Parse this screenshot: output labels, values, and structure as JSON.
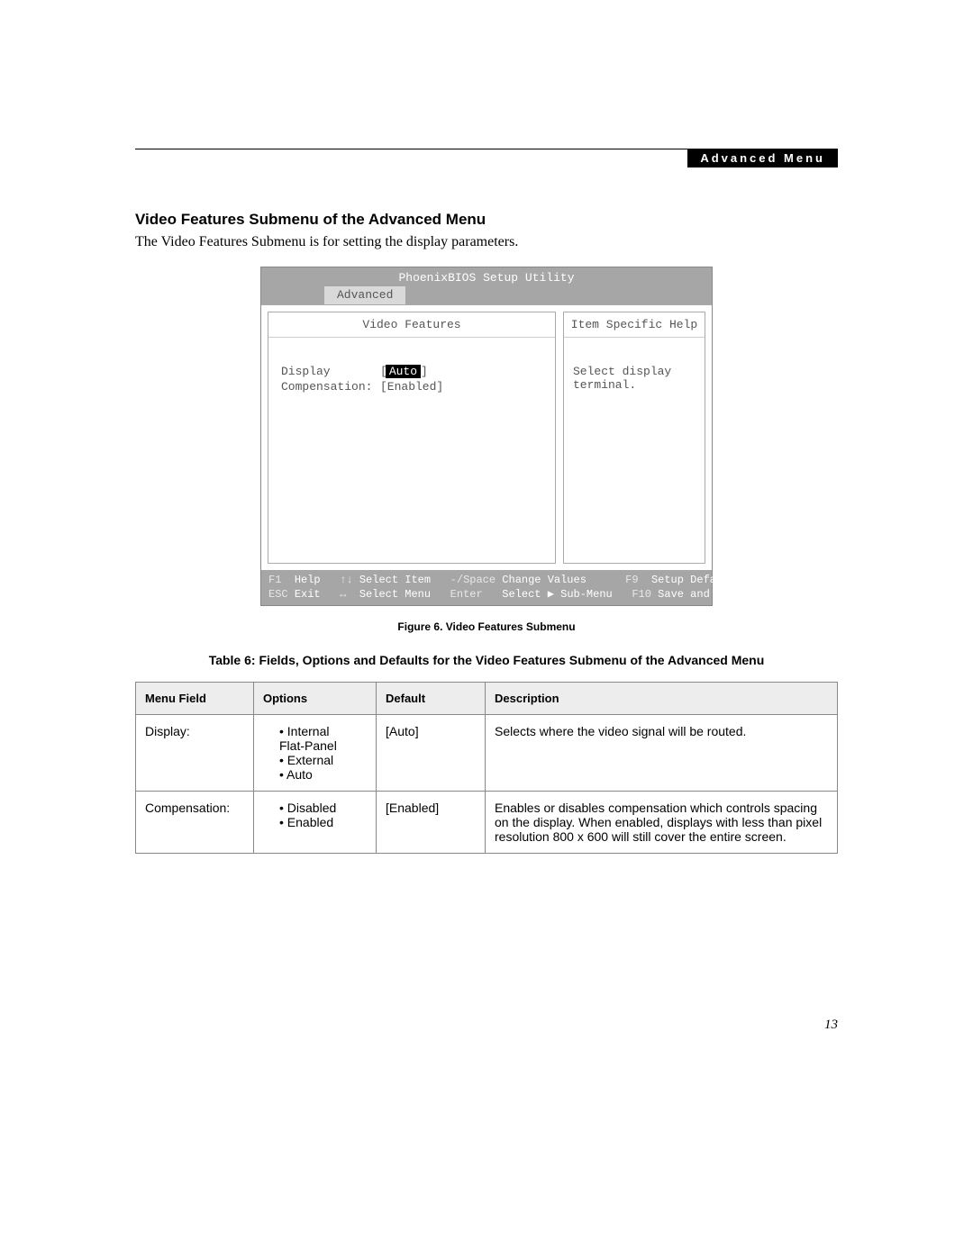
{
  "header": {
    "banner": "Advanced Menu"
  },
  "section": {
    "title": "Video Features Submenu of the Advanced Menu",
    "intro": "The Video Features Submenu is for setting the display parameters."
  },
  "bios": {
    "utility_title": "PhoenixBIOS Setup Utility",
    "active_tab": "Advanced",
    "left_header": "Video Features",
    "right_header": "Item Specific Help",
    "fields": {
      "display_label": "Display",
      "display_value": "Auto",
      "display_bracket_open": "[",
      "display_bracket_close": "]",
      "comp_label": "Compensation:",
      "comp_value": "[Enabled]"
    },
    "help_text": "Select display terminal.",
    "footer": {
      "r1_k1": "F1",
      "r1_l1": "Help",
      "r1_k2": "↑↓",
      "r1_l2": "Select Item",
      "r1_k3": "-/Space",
      "r1_l3": "Change Values",
      "r1_k4": "F9",
      "r1_l4": "Setup Defaults",
      "r2_k1": "ESC",
      "r2_l1": "Exit",
      "r2_k2": "↔",
      "r2_l2": "Select Menu",
      "r2_k3": "Enter",
      "r2_l3": "Select ▶ Sub-Menu",
      "r2_k4": "F10",
      "r2_l4": "Save and Exit"
    }
  },
  "figure_caption": "Figure 6.  Video Features Submenu",
  "table_caption": "Table 6: Fields, Options and Defaults for the Video Features Submenu of the Advanced Menu",
  "table": {
    "headers": {
      "menu_field": "Menu Field",
      "options": "Options",
      "default": "Default",
      "description": "Description"
    },
    "rows": [
      {
        "menu_field": "Display:",
        "options_raw": [
          "Internal",
          "Flat-Panel",
          "External",
          "Auto"
        ],
        "options_indent": [
          false,
          true,
          false,
          false
        ],
        "default": "[Auto]",
        "description": "Selects where the video signal will be routed."
      },
      {
        "menu_field": "Compensation:",
        "options_raw": [
          "Disabled",
          "Enabled"
        ],
        "options_indent": [
          false,
          false
        ],
        "default": "[Enabled]",
        "description": "Enables or disables compensation which controls spacing on the display. When enabled, displays with less than pixel resolution 800 x 600 will still cover the entire screen."
      }
    ]
  },
  "page_number": "13"
}
